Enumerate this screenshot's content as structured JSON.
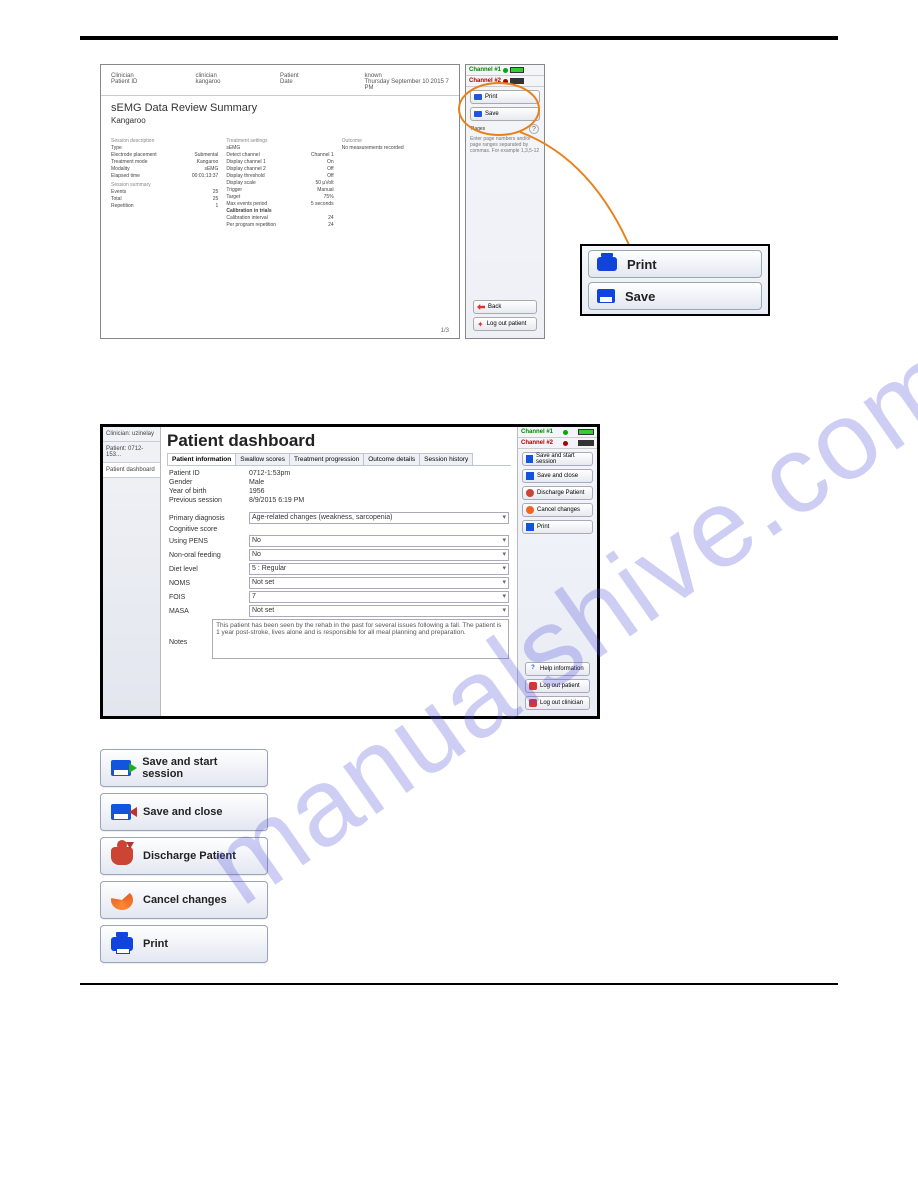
{
  "watermark": "manualshive.com",
  "report": {
    "header_labels": [
      "Clinician",
      "Patient ID",
      "Patient",
      "Date"
    ],
    "header_values": [
      "clinician",
      "kangaroo",
      "known",
      "Thursday September 10 2015 7 PM"
    ],
    "title": "sEMG Data Review Summary",
    "patient": "Kangaroo",
    "col_headings": [
      "Session description",
      "Treatment settings",
      "Outcome"
    ],
    "session_desc": [
      [
        "Type",
        ""
      ],
      [
        "Electrode placement",
        "Submental"
      ],
      [
        "Treatment mode",
        "Kangaroo"
      ],
      [
        "Modality",
        "sEMG"
      ],
      [
        "Elapsed time",
        "00:01:13:37"
      ]
    ],
    "session_summary_heading": "Session summary",
    "session_summary": [
      [
        "Events",
        "25"
      ],
      [
        "Total",
        "25"
      ],
      [
        "Repetition",
        "1"
      ]
    ],
    "treatment": [
      [
        "sEMG",
        ""
      ],
      [
        "Detect channel",
        "Channel 1"
      ],
      [
        "Display channel 1",
        "On"
      ],
      [
        "Display channel 2",
        "Off"
      ],
      [
        "Display threshold",
        "Off"
      ],
      [
        "Display scale",
        "50 µVolt"
      ],
      [
        "Trigger",
        "Manual"
      ],
      [
        "Target",
        "75%"
      ],
      [
        "Max events period",
        "5 seconds"
      ],
      [
        "Calibration in trials",
        ""
      ],
      [
        "Calibration interval",
        "24"
      ],
      [
        "Per program repetition",
        "24"
      ]
    ],
    "outcome": [
      [
        "No measurements recorded",
        ""
      ]
    ],
    "page_indicator": "1/3"
  },
  "sidepanel": {
    "channel1": "Channel #1",
    "channel2": "Channel #2",
    "print": "Print",
    "save": "Save",
    "pages": "Pages",
    "hint": "Enter page numbers and/or page ranges separated by commas. For example 1,3,5-12",
    "back": "Back",
    "logout": "Log out patient"
  },
  "zoom": {
    "print": "Print",
    "save": "Save"
  },
  "dashboard": {
    "title": "Patient dashboard",
    "sidebar": {
      "clinician": "Clinician: uzinelay",
      "patient": "Patient: 0712-153...",
      "current": "Patient dashboard"
    },
    "tabs": [
      "Patient information",
      "Swallow scores",
      "Treatment progression",
      "Outcome details",
      "Session history"
    ],
    "fields": {
      "patient_id_lbl": "Patient ID",
      "patient_id": "0712-1:53pm",
      "gender_lbl": "Gender",
      "gender": "Male",
      "yob_lbl": "Year of birth",
      "yob": "1956",
      "prev_lbl": "Previous session",
      "prev": "8/9/2015 6:19 PM",
      "diag_lbl": "Primary diagnosis",
      "diag": "Age-related changes (weakness, sarcopenia)",
      "cog_lbl": "Cognitive score",
      "cog": "",
      "pens_lbl": "Using PENS",
      "pens": "No",
      "feeding_lbl": "Non-oral feeding",
      "feeding": "No",
      "diet_lbl": "Diet level",
      "diet": "5 : Regular",
      "noms_lbl": "NOMS",
      "noms": "Not set",
      "fois_lbl": "FOIS",
      "fois": "7",
      "masa_lbl": "MASA",
      "masa": "Not set",
      "notes_lbl": "Notes",
      "notes": "This patient has been seen by the rehab in the past for several issues following a fall. The patient is 1 year post-stroke, lives alone and is responsible for all meal planning and preparation."
    },
    "right": {
      "ch1": "Channel #1",
      "ch2": "Channel #2",
      "save_start": "Save and start session",
      "save_close": "Save and close",
      "discharge": "Discharge Patient",
      "cancel": "Cancel changes",
      "print": "Print",
      "help": "Help information",
      "logout_patient": "Log out patient",
      "logout_clinician": "Log out clinician"
    }
  },
  "buttons": {
    "save_start": "Save and start session",
    "save_close": "Save and close",
    "discharge": "Discharge Patient",
    "cancel": "Cancel changes",
    "print": "Print"
  }
}
